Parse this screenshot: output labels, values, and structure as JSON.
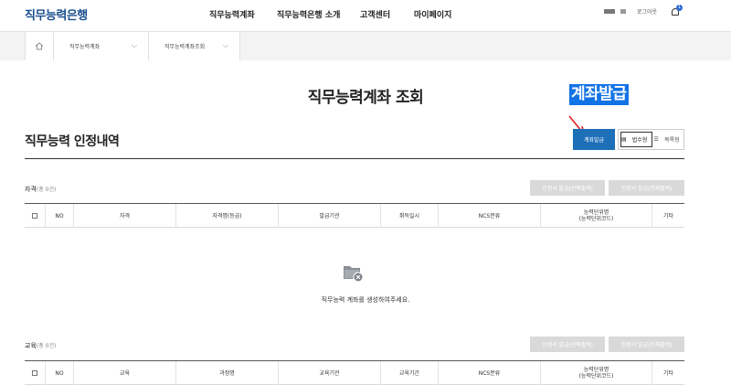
{
  "header": {
    "logo": "직무능력은행",
    "nav": [
      "직무능력계좌",
      "직무능력은행 소개",
      "고객센터",
      "마이페이지"
    ],
    "login": "로그아웃",
    "notification_count": "1"
  },
  "breadcrumb": {
    "home_icon": "home-icon",
    "items": [
      "직무능력계좌",
      "직무능력계좌조회"
    ]
  },
  "page": {
    "title": "직무능력계좌 조회",
    "annotation": "계좌발급"
  },
  "section": {
    "title": "직무능력 인정내역",
    "issue_button": "계좌발급",
    "view_options": [
      "법수형",
      "목록형"
    ]
  },
  "qualification": {
    "title": "자격",
    "count": "(총 0건)",
    "btn_selected": "인정서 발급(선택출력)",
    "btn_all": "인정서 발급(전체출력)",
    "columns": [
      "NO",
      "자격",
      "자격명(등급)",
      "발급기관",
      "취득일시",
      "NCS분류",
      "능력단위명\n(능력단위코드)",
      "기타"
    ],
    "empty_message": "직무능력 계좌를 생성하여주세요."
  },
  "education": {
    "title": "교육",
    "count": "(총 0건)",
    "btn_selected": "인정서 발급(선택출력)",
    "btn_all": "인정서 발급(전체출력)",
    "columns": [
      "NO",
      "교육",
      "과정명",
      "교육기관",
      "교육기간",
      "NCS분류",
      "능력단위명\n(능력단위코드)",
      "기타"
    ]
  },
  "colors": {
    "brand": "#1a4f8f",
    "primary_button": "#1d6fb8",
    "annotation": "#1273e5",
    "arrow": "#e02020",
    "disabled_button": "#d9d9d9"
  }
}
